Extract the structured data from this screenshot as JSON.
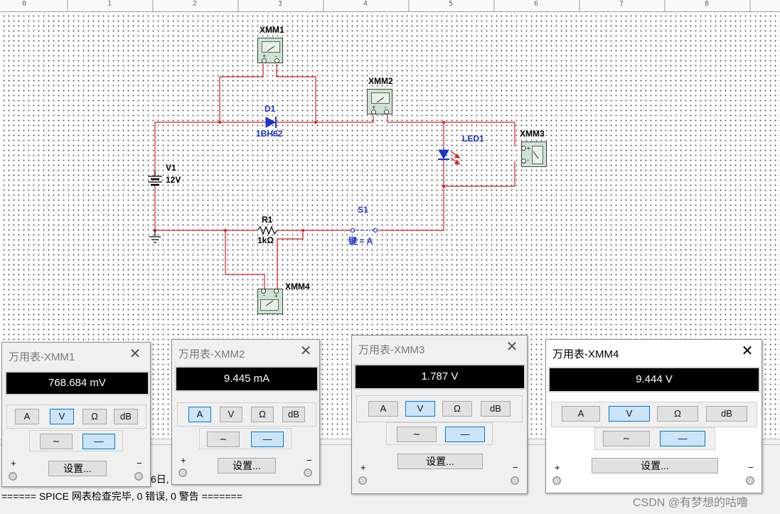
{
  "ruler": {
    "ticks": [
      "0",
      "1",
      "2",
      "3",
      "4",
      "5",
      "6",
      "7",
      "8"
    ]
  },
  "schematic": {
    "xmm1": "XMM1",
    "xmm2": "XMM2",
    "xmm3": "XMM3",
    "xmm4": "XMM4",
    "d1_ref": "D1",
    "d1_value": "1BH62",
    "led_ref": "LED1",
    "v1_ref": "V1",
    "v1_value": "12V",
    "r1_ref": "R1",
    "r1_value": "1kΩ",
    "s1_ref": "S1",
    "s1_key": "键 = A",
    "mm_plus": "+",
    "mm_minus": "-"
  },
  "meters": [
    {
      "title": "万用表-XMM1",
      "reading": "768.684 mV",
      "selected": "V"
    },
    {
      "title": "万用表-XMM2",
      "reading": "9.445 mA",
      "selected": "A"
    },
    {
      "title": "万用表-XMM3",
      "reading": "1.787 V",
      "selected": "V"
    },
    {
      "title": "万用表-XMM4",
      "reading": "9.444 V",
      "selected": "V"
    }
  ],
  "meter_buttons": {
    "amp": "A",
    "volt": "V",
    "ohm": "Ω",
    "db": "dB",
    "ac": "∼",
    "dc": "—",
    "settings": "设置...",
    "plus": "+",
    "minus": "−",
    "close": "✕"
  },
  "bottom": {
    "partial_text": "6日,",
    "status": "====== SPICE 网表检查完毕, 0 错误, 0 警告 =======",
    "watermark": "CSDN @有梦想的咕噜"
  },
  "colors": {
    "wire": "#d42020",
    "component_blue": "#1a33cc",
    "display_bg": "#000000",
    "selected_button": "#cce4f7"
  }
}
